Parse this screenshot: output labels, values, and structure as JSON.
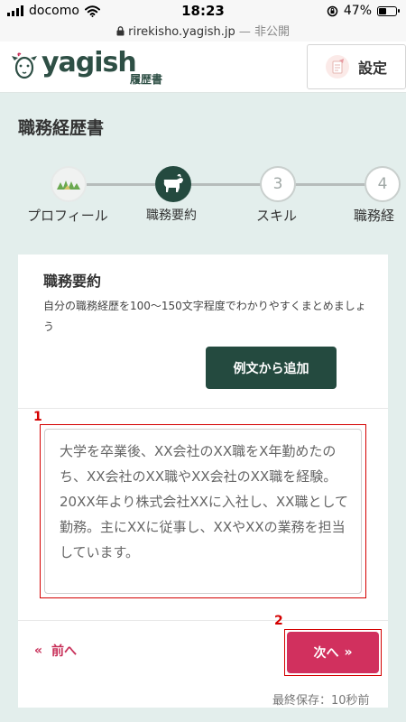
{
  "status_bar": {
    "carrier": "docomo",
    "time": "18:23",
    "battery_percent": "47%",
    "battery_level": 0.47
  },
  "url_bar": {
    "url": "rirekisho.yagish.jp",
    "separator": " — ",
    "privacy": "非公開"
  },
  "header": {
    "logo": "yagish",
    "logo_sub": "履歴書",
    "settings_label": "設定"
  },
  "page": {
    "title": "職務経歴書"
  },
  "steps": [
    {
      "number": "",
      "label": "プロフィール",
      "state": "done"
    },
    {
      "number": "",
      "label": "職務要約",
      "state": "active"
    },
    {
      "number": "3",
      "label": "スキル",
      "state": "todo"
    },
    {
      "number": "4",
      "label": "職務経",
      "state": "todo"
    }
  ],
  "section": {
    "title": "職務要約",
    "description": "自分の職務経歴を100〜150文字程度でわかりやすくまとめましょう",
    "example_button": "例文から追加",
    "summary_text": "大学を卒業後、XX会社のXX職をX年勤めたのち、XX会社のXX職やXX会社のXX職を経験。20XX年より株式会社XXに入社し、XX職として勤務。主にXXに従事し、XXやXXの業務を担当しています。"
  },
  "annotations": {
    "textarea_marker": "1",
    "next_marker": "2"
  },
  "nav": {
    "prev_icon": "«",
    "prev_label": "前へ",
    "next_label": "次へ",
    "next_icon": "»"
  },
  "save_status": "最終保存：10秒前",
  "colors": {
    "primary_green": "#244a3f",
    "accent_red": "#d1305e",
    "annotation_red": "#d40000",
    "background": "#e3eeec"
  }
}
